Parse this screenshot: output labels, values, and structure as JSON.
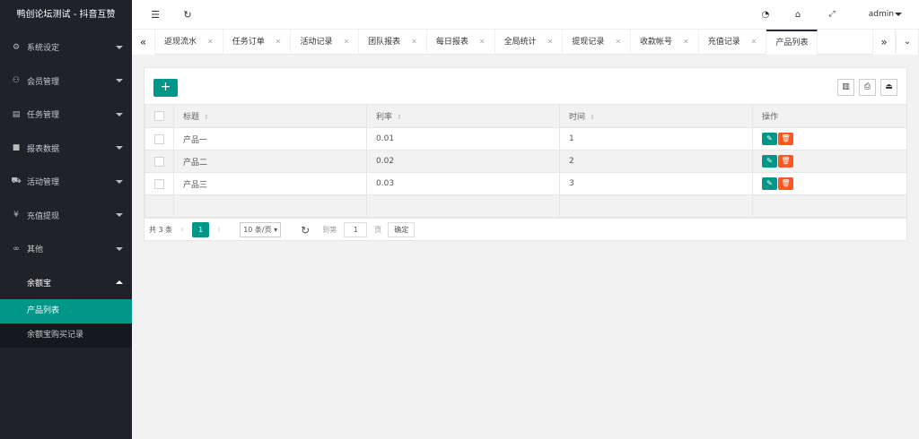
{
  "app": {
    "title": "鸭创论坛测试 - 抖音互赞"
  },
  "sidebar": {
    "items": [
      {
        "label": "系统设定",
        "icon": "gear-icon"
      },
      {
        "label": "会员管理",
        "icon": "user-icon"
      },
      {
        "label": "任务管理",
        "icon": "document-icon"
      },
      {
        "label": "报表数据",
        "icon": "book-icon"
      },
      {
        "label": "活动管理",
        "icon": "car-icon"
      },
      {
        "label": "充值提现",
        "icon": "yen-icon"
      },
      {
        "label": "其他",
        "icon": "link-icon"
      },
      {
        "label": "余额宝",
        "icon": ""
      }
    ],
    "subitems": [
      {
        "label": "产品列表"
      },
      {
        "label": "余额宝购买记录"
      }
    ]
  },
  "header": {
    "user": "admin"
  },
  "tabs": [
    "返现流水",
    "任务订单",
    "活动记录",
    "团队报表",
    "每日报表",
    "全局统计",
    "提现记录",
    "收款帐号",
    "充值记录",
    "产品列表"
  ],
  "table": {
    "columns": [
      "标题",
      "利率",
      "时间",
      "操作"
    ],
    "rows": [
      {
        "title": "产品一",
        "rate": "0.01",
        "time": "1"
      },
      {
        "title": "产品二",
        "rate": "0.02",
        "time": "2"
      },
      {
        "title": "产品三",
        "rate": "0.03",
        "time": "3"
      }
    ]
  },
  "pager": {
    "total": "共 3 条",
    "current": "1",
    "page_size": "10 条/页",
    "goto_label": "到第",
    "goto_value": "1",
    "page_label": "页",
    "confirm": "确定"
  }
}
